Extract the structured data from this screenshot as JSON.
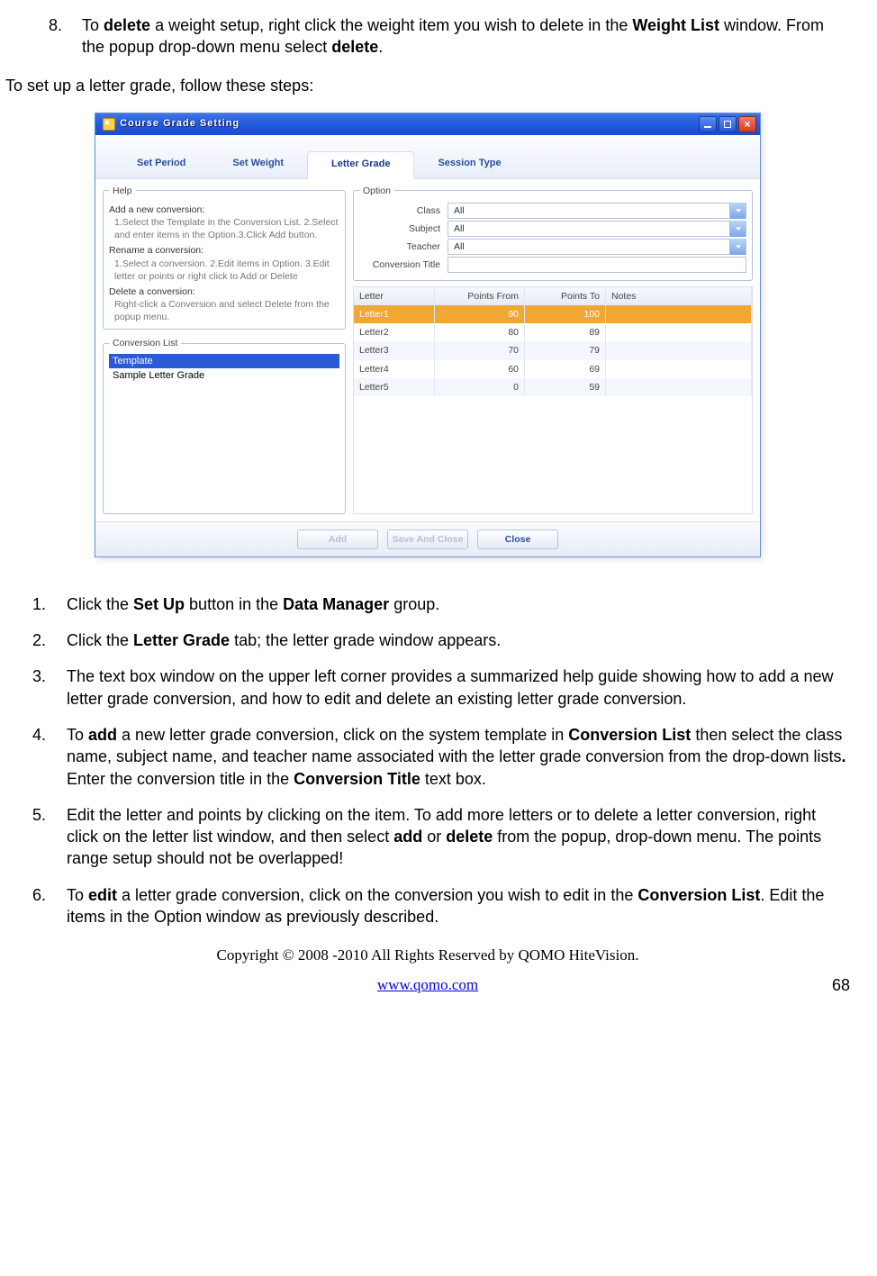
{
  "top_item": {
    "num": "8.",
    "parts": [
      "To ",
      "delete",
      " a weight setup, right click the weight item you wish to delete in the ",
      "Weight List",
      " window. From the popup drop-down menu select ",
      "delete",
      "."
    ]
  },
  "lead": "To set up a letter grade, follow these steps:",
  "window": {
    "title": "Course Grade Setting",
    "tabs": [
      "Set Period",
      "Set Weight",
      "Letter Grade",
      "Session Type"
    ],
    "active_tab": 2,
    "help": {
      "legend": "Help",
      "sections": [
        {
          "head": "Add a new conversion:",
          "body": "1.Select the Template in the Conversion List. 2.Select and enter items in the Option.3.Click Add button."
        },
        {
          "head": "Rename a conversion:",
          "body": "1.Select a conversion. 2.Edit items in Option. 3.Edit letter or points or right click to Add or Delete"
        },
        {
          "head": "Delete a conversion:",
          "body": "Right-click a Conversion and select Delete from the popup menu."
        }
      ]
    },
    "conversion_list": {
      "legend": "Conversion List",
      "items": [
        "Template",
        "Sample Letter Grade"
      ],
      "selected": 0
    },
    "option": {
      "legend": "Option",
      "class_label": "Class",
      "class_value": "All",
      "subject_label": "Subject",
      "subject_value": "All",
      "teacher_label": "Teacher",
      "teacher_value": "All",
      "title_label": "Conversion Title",
      "title_value": ""
    },
    "grid": {
      "columns": [
        "Letter",
        "Points From",
        "Points To",
        "Notes"
      ],
      "rows": [
        {
          "letter": "Letter1",
          "from": "90",
          "to": "100",
          "notes": "",
          "sel": true
        },
        {
          "letter": "Letter2",
          "from": "80",
          "to": "89",
          "notes": ""
        },
        {
          "letter": "Letter3",
          "from": "70",
          "to": "79",
          "notes": ""
        },
        {
          "letter": "Letter4",
          "from": "60",
          "to": "69",
          "notes": ""
        },
        {
          "letter": "Letter5",
          "from": "0",
          "to": "59",
          "notes": ""
        }
      ]
    },
    "buttons": {
      "add": "Add",
      "save": "Save And Close",
      "close": "Close"
    }
  },
  "steps": [
    {
      "n": "1.",
      "parts": [
        "Click the ",
        "Set Up",
        " button in the ",
        "Data Manager",
        " group."
      ]
    },
    {
      "n": "2.",
      "parts": [
        "Click the ",
        "Letter Grade",
        " tab; the letter grade window appears."
      ]
    },
    {
      "n": "3.",
      "plain": "The text box window on the upper left corner provides a summarized help guide showing how to add a new letter grade conversion, and how to edit and delete an existing letter grade conversion."
    },
    {
      "n": "4.",
      "parts": [
        "To ",
        "add",
        " a new letter grade conversion, click on the system template in ",
        "Conversion List",
        " then select the class name, subject name, and teacher name associated with the letter grade conversion from the drop-down lists",
        ".",
        " Enter the conversion title in the ",
        "Conversion Title",
        " text box."
      ]
    },
    {
      "n": "5.",
      "parts": [
        "Edit the letter and points by clicking on the item. To add more letters or to delete a letter conversion, right click on the letter list window, and then select ",
        "add",
        " or ",
        "delete",
        " from the popup, drop-down menu. The points range setup should not be overlapped!"
      ]
    },
    {
      "n": "6.",
      "parts": [
        "To ",
        "edit",
        " a letter grade conversion, click on the conversion you wish to edit in the ",
        "Conversion List",
        ". Edit the items in the Option window as previously described."
      ]
    }
  ],
  "footer": {
    "copyright": "Copyright © 2008 -2010 All Rights Reserved by QOMO HiteVision.",
    "url": "www.qomo.com",
    "page": "68"
  }
}
